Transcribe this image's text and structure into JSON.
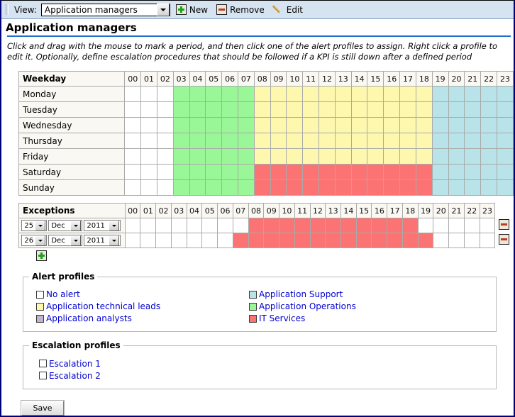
{
  "toolbar": {
    "view_label": "View:",
    "view_selected": "Application managers",
    "new_label": "New",
    "remove_label": "Remove",
    "edit_label": "Edit"
  },
  "page": {
    "title": "Application managers",
    "description": "Click and drag with the mouse to mark a period, and then click one of the alert profiles to assign. Right click a profile to edit it. Optionally, define escalation procedures that should be followed if a KPI is still down after a defined period"
  },
  "hours": [
    "00",
    "01",
    "02",
    "03",
    "04",
    "05",
    "06",
    "07",
    "08",
    "09",
    "10",
    "11",
    "12",
    "13",
    "14",
    "15",
    "16",
    "17",
    "18",
    "19",
    "20",
    "21",
    "22",
    "23"
  ],
  "weekday_table": {
    "header": "Weekday",
    "rows": [
      {
        "label": "Monday",
        "colors": [
          "white",
          "white",
          "white",
          "green",
          "green",
          "green",
          "green",
          "green",
          "yellow",
          "yellow",
          "yellow",
          "yellow",
          "yellow",
          "yellow",
          "yellow",
          "yellow",
          "yellow",
          "yellow",
          "yellow",
          "blue",
          "blue",
          "blue",
          "blue",
          "blue"
        ]
      },
      {
        "label": "Tuesday",
        "colors": [
          "white",
          "white",
          "white",
          "green",
          "green",
          "green",
          "green",
          "green",
          "yellow",
          "yellow",
          "yellow",
          "yellow",
          "yellow",
          "yellow",
          "yellow",
          "yellow",
          "yellow",
          "yellow",
          "yellow",
          "blue",
          "blue",
          "blue",
          "blue",
          "blue"
        ]
      },
      {
        "label": "Wednesday",
        "colors": [
          "white",
          "white",
          "white",
          "green",
          "green",
          "green",
          "green",
          "green",
          "yellow",
          "yellow",
          "yellow",
          "yellow",
          "yellow",
          "yellow",
          "yellow",
          "yellow",
          "yellow",
          "yellow",
          "yellow",
          "blue",
          "blue",
          "blue",
          "blue",
          "blue"
        ]
      },
      {
        "label": "Thursday",
        "colors": [
          "white",
          "white",
          "white",
          "green",
          "green",
          "green",
          "green",
          "green",
          "yellow",
          "yellow",
          "yellow",
          "yellow",
          "yellow",
          "yellow",
          "yellow",
          "yellow",
          "yellow",
          "yellow",
          "yellow",
          "blue",
          "blue",
          "blue",
          "blue",
          "blue"
        ]
      },
      {
        "label": "Friday",
        "colors": [
          "white",
          "white",
          "white",
          "green",
          "green",
          "green",
          "green",
          "green",
          "yellow",
          "yellow",
          "yellow",
          "yellow",
          "yellow",
          "yellow",
          "yellow",
          "yellow",
          "yellow",
          "yellow",
          "yellow",
          "blue",
          "blue",
          "blue",
          "blue",
          "blue"
        ]
      },
      {
        "label": "Saturday",
        "colors": [
          "white",
          "white",
          "white",
          "green",
          "green",
          "green",
          "green",
          "green",
          "red",
          "red",
          "red",
          "red",
          "red",
          "red",
          "red",
          "red",
          "red",
          "red",
          "red",
          "blue",
          "blue",
          "blue",
          "blue",
          "blue"
        ]
      },
      {
        "label": "Sunday",
        "colors": [
          "white",
          "white",
          "white",
          "green",
          "green",
          "green",
          "green",
          "green",
          "red",
          "red",
          "red",
          "red",
          "red",
          "red",
          "red",
          "red",
          "red",
          "red",
          "red",
          "blue",
          "blue",
          "blue",
          "blue",
          "blue"
        ]
      }
    ]
  },
  "exceptions_table": {
    "header": "Exceptions",
    "rows": [
      {
        "day": "25",
        "month": "Dec",
        "year": "2011",
        "colors": [
          "white",
          "white",
          "white",
          "white",
          "white",
          "white",
          "white",
          "white",
          "red",
          "red",
          "red",
          "red",
          "red",
          "red",
          "red",
          "red",
          "red",
          "red",
          "red",
          "white",
          "white",
          "white",
          "white",
          "white"
        ],
        "remove_title": "Remove"
      },
      {
        "day": "26",
        "month": "Dec",
        "year": "2011",
        "colors": [
          "white",
          "white",
          "white",
          "white",
          "white",
          "white",
          "white",
          "red",
          "red",
          "red",
          "red",
          "red",
          "red",
          "red",
          "red",
          "red",
          "red",
          "red",
          "red",
          "red",
          "white",
          "white",
          "white",
          "white"
        ],
        "remove_title": "Remove"
      }
    ],
    "add_title": "Add exception"
  },
  "alert_profiles": {
    "legend": "Alert profiles",
    "items": [
      {
        "label": "No alert",
        "color": "#ffffff"
      },
      {
        "label": "Application Support",
        "color": "#b8e3e9"
      },
      {
        "label": "Application technical leads",
        "color": "#fdf8ae"
      },
      {
        "label": "Application Operations",
        "color": "#99f798"
      },
      {
        "label": "Application analysts",
        "color": "#c4b2cf"
      },
      {
        "label": "IT Services",
        "color": "#fb7373"
      }
    ]
  },
  "escalation_profiles": {
    "legend": "Escalation profiles",
    "items": [
      {
        "label": "Escalation 1"
      },
      {
        "label": "Escalation 2"
      }
    ]
  },
  "footer": {
    "save_label": "Save"
  }
}
